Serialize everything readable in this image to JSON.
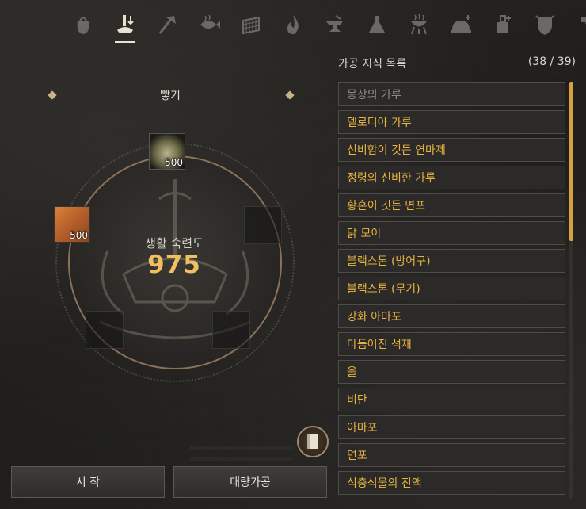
{
  "tabs": [
    {
      "name": "tab-gathering",
      "icon": "gathering-bag-icon"
    },
    {
      "name": "tab-processing",
      "icon": "processing-hand-icon",
      "active": true
    },
    {
      "name": "tab-woodcutting",
      "icon": "axe-icon"
    },
    {
      "name": "tab-fishing",
      "icon": "fish-icon"
    },
    {
      "name": "tab-grinding",
      "icon": "grill-net-icon"
    },
    {
      "name": "tab-heating",
      "icon": "flame-icon"
    },
    {
      "name": "tab-smithing",
      "icon": "anvil-icon"
    },
    {
      "name": "tab-alchemy",
      "icon": "flask-icon"
    },
    {
      "name": "tab-cooking",
      "icon": "bbq-grill-icon"
    },
    {
      "name": "tab-serving",
      "icon": "cloche-icon"
    },
    {
      "name": "tab-chemistry",
      "icon": "lab-icon"
    },
    {
      "name": "tab-guild",
      "icon": "shield-crest-icon"
    },
    {
      "name": "tab-repair",
      "icon": "hammer-icon"
    }
  ],
  "recipe": {
    "title": "빻기",
    "skill_label": "생활 숙련도",
    "skill_value": "975"
  },
  "slots": {
    "top_item": {
      "qty": "500",
      "icon": "jar-icon"
    },
    "left_item": {
      "qty": "500",
      "icon": "plank-icon"
    }
  },
  "buttons": {
    "start": "시 작",
    "mass_process": "대량가공"
  },
  "knowledge_list": {
    "title": "가공 지식 목록",
    "count": "(38 / 39)",
    "items": [
      {
        "label": "몽상의 가루",
        "disabled": true
      },
      {
        "label": "델로티아 가루"
      },
      {
        "label": "신비함이 깃든 연마제"
      },
      {
        "label": "정령의 신비한 가루"
      },
      {
        "label": "황혼이 깃든 면포"
      },
      {
        "label": "닭 모이"
      },
      {
        "label": "블랙스톤 (방어구)"
      },
      {
        "label": "블랙스톤 (무기)"
      },
      {
        "label": "강화 아마포"
      },
      {
        "label": "다듬어진 석재"
      },
      {
        "label": "울"
      },
      {
        "label": "비단"
      },
      {
        "label": "아마포"
      },
      {
        "label": "면포"
      },
      {
        "label": "식충식물의 진액"
      }
    ]
  },
  "colors": {
    "accent": "#e9b342",
    "skill_value": "#f0c060",
    "disabled_text": "#8e8c86"
  }
}
